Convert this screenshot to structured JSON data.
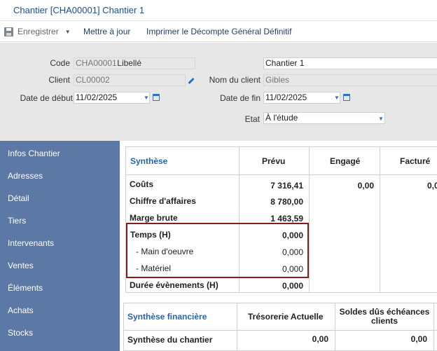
{
  "window": {
    "title": "Chantier [CHA00001] Chantier 1"
  },
  "toolbar": {
    "save_label": "Enregistrer",
    "update_label": "Mettre à jour",
    "print_label": "Imprimer le Décompte Général Définitif"
  },
  "form": {
    "code_label": "Code",
    "code_value": "CHA00001",
    "client_label": "Client",
    "client_value": "CL00002",
    "start_label": "Date de début",
    "start_value": "11/02/2025",
    "libelle_label": "Libellé",
    "libelle_value": "Chantier 1",
    "client_name_label": "Nom du client",
    "client_name_value": "Gibles",
    "end_label": "Date de fin",
    "end_value": "11/02/2025",
    "etat_label": "Etat",
    "etat_value": "À l'étude"
  },
  "sidebar": {
    "items": [
      "Infos Chantier",
      "Adresses",
      "Détail",
      "Tiers",
      "Intervenants",
      "Ventes",
      "Éléments",
      "Achats",
      "Stocks"
    ]
  },
  "synthese": {
    "title": "Synthèse",
    "col_prevu": "Prévu",
    "col_engage": "Engagé",
    "col_facture": "Facturé",
    "rows": {
      "couts_label": "Coûts",
      "couts_prevu": "7 316,41",
      "couts_engage": "0,00",
      "couts_facture": "0,0",
      "ca_label": "Chiffre d'affaires",
      "ca_prevu": "8 780,00",
      "marge_label": "Marge brute",
      "marge_prevu": "1 463,59",
      "temps_label": "Temps (H)",
      "temps_prevu": "0,000",
      "mo_label": "- Main d'oeuvre",
      "mo_prevu": "0,000",
      "mat_label": "- Matériel",
      "mat_prevu": "0,000",
      "duree_label": "Durée évènements (H)",
      "duree_prevu": "0,000"
    }
  },
  "synthese_fin": {
    "title": "Synthèse financière",
    "col_treso": "Trésorerie Actuelle",
    "col_soldes": "Soldes dûs échéances clients",
    "row_label": "Synthèse du chantier",
    "row_treso": "0,00",
    "row_soldes": "0,00"
  },
  "colors": {
    "accent": "#2a63a8",
    "sidebar": "#5c79a6",
    "highlight": "#8b1a1a"
  }
}
